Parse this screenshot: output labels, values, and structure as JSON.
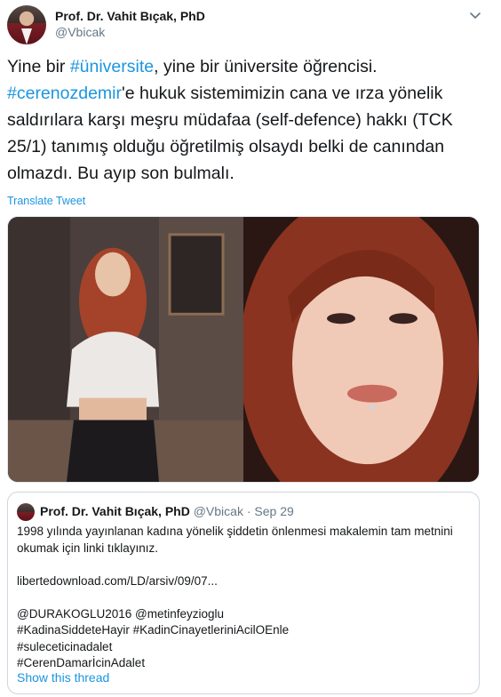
{
  "author": {
    "name": "Prof. Dr. Vahit Bıçak, PhD",
    "handle": "@Vbicak"
  },
  "tweet": {
    "hashtag1": "#üniversite",
    "part1": "Yine bir ",
    "part2": ", yine bir üniversite öğrencisi.",
    "hashtag2": "#cerenozdemir",
    "part3": "'e hukuk sistemimizin cana ve ırza yönelik saldırılara karşı meşru müdafaa (self-defence) hakkı (TCK 25/1) tanımış olduğu öğretilmiş olsaydı belki de canından olmazdı. Bu ayıp son bulmalı."
  },
  "translate_label": "Translate Tweet",
  "quoted": {
    "name": "Prof. Dr. Vahit Bıçak, PhD",
    "handle": "@Vbicak",
    "separator": " · ",
    "date": "Sep 29",
    "line1": "1998 yılında yayınlanan kadına yönelik şiddetin önlenmesi makalemin tam metnini okumak için linki tıklayınız.",
    "link": "libertedownload.com/LD/arsiv/09/07...",
    "mentions": "@DURAKOGLU2016 @metinfeyzioglu",
    "tag_line1": "#KadinaSiddeteHayir #KadinCinayetleriniAcilOEnle",
    "tag_line2": "#suleceticinadalet",
    "tag_line3": "#CerenDamarİcinAdalet",
    "show_thread": "Show this thread"
  },
  "icons": {
    "caret": "chevron-down-icon"
  },
  "colors": {
    "link": "#1b95e0",
    "secondary": "#657786",
    "border": "#ccd6dd"
  }
}
